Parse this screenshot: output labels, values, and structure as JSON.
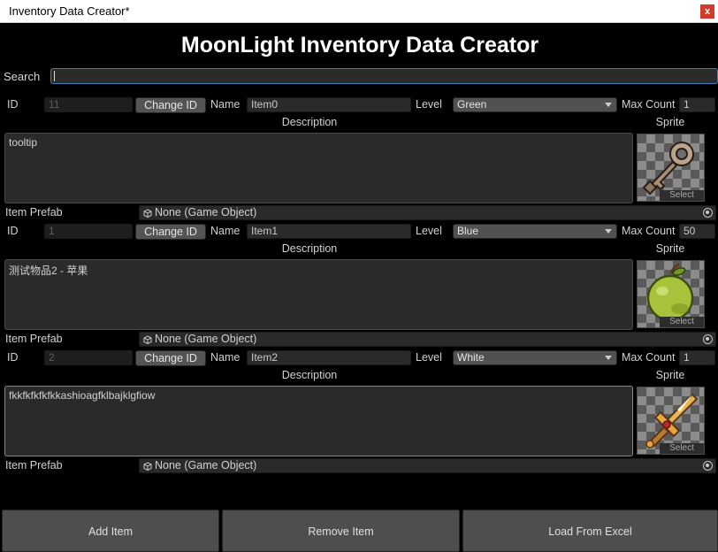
{
  "window": {
    "title": "Inventory Data Creator*",
    "close_label": "x"
  },
  "header": {
    "title": "MoonLight Inventory Data Creator"
  },
  "search": {
    "label": "Search",
    "value": ""
  },
  "labels": {
    "id": "ID",
    "change_id": "Change ID",
    "name": "Name",
    "level": "Level",
    "max_count": "Max Count",
    "description": "Description",
    "sprite": "Sprite",
    "sprite_select": "Select",
    "item_prefab": "Item Prefab"
  },
  "items": [
    {
      "id": "11",
      "name": "Item0",
      "level": "Green",
      "max_count": "1",
      "description": "tooltip",
      "sprite_icon": "key-icon",
      "prefab": "None (Game Object)"
    },
    {
      "id": "1",
      "name": "Item1",
      "level": "Blue",
      "max_count": "50",
      "description": "测试物品2 - 苹果",
      "sprite_icon": "apple-icon",
      "prefab": "None (Game Object)"
    },
    {
      "id": "2",
      "name": "Item2",
      "level": "White",
      "max_count": "1",
      "description": "fkkfkfkfkfkkashioagfklbajklgfiow",
      "sprite_icon": "sword-icon",
      "prefab": "None (Game Object)"
    }
  ],
  "footer": {
    "add": "Add Item",
    "remove": "Remove Item",
    "load": "Load From Excel"
  }
}
